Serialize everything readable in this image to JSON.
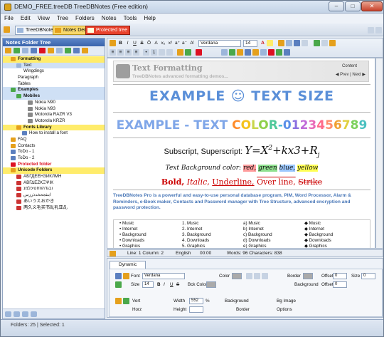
{
  "window": {
    "title": "DEMO_FREE.treeDB TreeDBNotes (Free edition)",
    "min": "–",
    "max": "□",
    "close": "✕"
  },
  "menu": [
    "File",
    "Edit",
    "View",
    "Tree",
    "Folders",
    "Notes",
    "Tools",
    "Help"
  ],
  "tabs": [
    {
      "label": "TreeDBNotes"
    },
    {
      "label": "Notes Demo"
    },
    {
      "label": "Protected tree"
    }
  ],
  "left": {
    "title": "Notes Folder Tree",
    "tree": [
      {
        "label": "Formatting",
        "bold": true,
        "cls": "bar",
        "indent": 1,
        "icon": "#e5a01c"
      },
      {
        "label": "Text",
        "indent": 2,
        "cls": "sel",
        "icon": "#9cb6da"
      },
      {
        "label": "Wingdings",
        "indent": 2,
        "icon": ""
      },
      {
        "label": "Paragraph",
        "indent": 1,
        "icon": ""
      },
      {
        "label": "Tables",
        "indent": 1,
        "icon": ""
      },
      {
        "label": "Examples",
        "bold": true,
        "cls": "sel",
        "indent": 1,
        "icon": "#4aa84a"
      },
      {
        "label": "Mobiles",
        "bold": true,
        "cls": "sel",
        "indent": 2,
        "icon": "#4aa84a"
      },
      {
        "label": "Nokia N90",
        "indent": 4,
        "icon": "#888"
      },
      {
        "label": "Nokia N93",
        "indent": 4,
        "icon": "#888"
      },
      {
        "label": "Motorola RAZR V3",
        "indent": 4,
        "icon": "#888"
      },
      {
        "label": "Motorola KRZR",
        "indent": 4,
        "icon": "#888"
      },
      {
        "label": "Fonts Library",
        "bold": true,
        "cls": "bar",
        "indent": 2,
        "icon": "#e5a01c"
      },
      {
        "label": "How to install a font",
        "indent": 3,
        "icon": "#5b7fbf"
      },
      {
        "label": "FAQ",
        "indent": 1,
        "icon": "#e5a01c"
      },
      {
        "label": "Contacts",
        "indent": 1,
        "icon": "#e5a01c"
      },
      {
        "label": "ToDo - 1",
        "indent": 1,
        "icon": "#5b7fbf"
      },
      {
        "label": "ToDo - 2",
        "indent": 1,
        "icon": "#5b7fbf"
      },
      {
        "label": "Protected folder",
        "bold": true,
        "cls": "red",
        "indent": 1,
        "icon": "#d12"
      },
      {
        "label": "Unicode Folders",
        "bold": true,
        "cls": "bar",
        "indent": 1,
        "icon": "#e5a01c"
      },
      {
        "label": "АБГДЕЁНЗИКЛМН",
        "indent": 2,
        "icon": "#c33"
      },
      {
        "label": "ΑΒΓΔΕΖΚΞΨΙΚ",
        "indent": 2,
        "icon": "#c33"
      },
      {
        "label": "ובגדהוזחטיכלמנ",
        "indent": 2,
        "icon": "#c33"
      },
      {
        "label": "ابتثجحخدذرزس",
        "indent": 2,
        "icon": "#c33"
      },
      {
        "label": "あいうえおかき",
        "indent": 2,
        "icon": "#c33"
      },
      {
        "label": "两久义毛买书乱乳亚乩",
        "indent": 2,
        "icon": "#c33"
      }
    ]
  },
  "editor": {
    "font": "Verdana",
    "size": "14"
  },
  "doc": {
    "banner_title": "Text Formatting",
    "banner_sub": "TreeDBNotes advanced formatting demos...",
    "content": "Content",
    "prevnext": "◀ Prev | Next ▶",
    "example_size": "EXAMPLE ☺ TEXT SIZE",
    "example_color_prefix": "EXAMPLE - TEXT ",
    "example_color_digits": "COLOR-0123456789",
    "subscript_label": "Subscript, Superscript:",
    "bg_label": "Text Background color:",
    "bg_words": [
      "red,",
      "green",
      "blue,",
      "yellow"
    ],
    "styles": {
      "bold": "Bold,",
      "italic": "Italic,",
      "underline": "Underline,",
      "overline": "Over line,",
      "strike": "Strike"
    },
    "para": "TreeDBNotes Pro is a powerful and easy-to-use personal database program, PIM, Word Processor, Alarm & Reminders, e-Book maker, Contacts and Password manager with Tree Structure, advanced encryption and password protection.",
    "list_items": [
      "Music",
      "Internet",
      "Background",
      "Downloads",
      "Graphics"
    ]
  },
  "status": {
    "line": "Line: 1 Column: 2",
    "lang": "English",
    "time": "00:00",
    "words": "Words: 96 Characters: 838"
  },
  "dynamic": {
    "tab": "Dynamic Editor",
    "font_label": "Font",
    "font_value": "Verdana",
    "size_label": "Size",
    "size_value": "14",
    "color": "Color",
    "bk_color": "Bck Color",
    "border": "Border",
    "offset": "Offset",
    "offset_v": "0",
    "size2": "Size",
    "size2_v": "0",
    "background": "Background",
    "vert": "Vert",
    "horz": "Horz",
    "width": "Width",
    "width_v": "552",
    "pct": "%",
    "height": "Height",
    "bg_image": "Bg Image",
    "options": "Options"
  },
  "bottom": {
    "text": "Folders: 25 | Selected: 1"
  }
}
